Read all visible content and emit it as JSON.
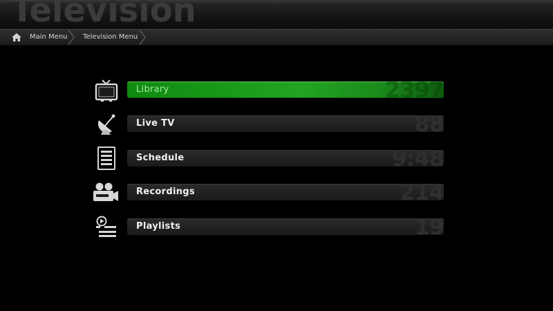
{
  "header": {
    "title": "Television"
  },
  "breadcrumb": {
    "home_icon": "home-icon",
    "items": [
      {
        "label": "Main Menu"
      },
      {
        "label": "Television Menu"
      }
    ]
  },
  "menu": {
    "selected_index": 0,
    "accent_color": "#1f9a1f",
    "items": [
      {
        "label": "Library",
        "value": "2397",
        "icon": "tv-icon"
      },
      {
        "label": "Live TV",
        "value": "88",
        "icon": "satellite-dish-icon"
      },
      {
        "label": "Schedule",
        "value": "9:48",
        "icon": "schedule-list-icon"
      },
      {
        "label": "Recordings",
        "value": "214",
        "icon": "video-camera-icon"
      },
      {
        "label": "Playlists",
        "value": "19",
        "icon": "playlist-icon"
      }
    ]
  }
}
